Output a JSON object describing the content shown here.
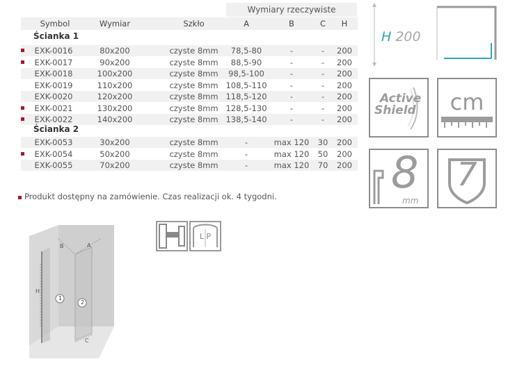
{
  "table": {
    "group_header": "Wymiary rzeczywiste",
    "columns": {
      "symbol": "Symbol",
      "wymiar": "Wymiar",
      "szklo": "Szkło",
      "a": "A",
      "b": "B",
      "c": "C",
      "h": "H"
    },
    "group1": {
      "title": "Ścianka 1",
      "rows": [
        {
          "bullet": true,
          "symbol": "EXK-0016",
          "wymiar": "80x200",
          "szklo": "czyste 8mm",
          "a": "78,5-80",
          "b": "-",
          "c": "-",
          "h": "200"
        },
        {
          "bullet": true,
          "symbol": "EXK-0017",
          "wymiar": "90x200",
          "szklo": "czyste 8mm",
          "a": "88,5-90",
          "b": "-",
          "c": "-",
          "h": "200"
        },
        {
          "bullet": false,
          "symbol": "EXK-0018",
          "wymiar": "100x200",
          "szklo": "czyste 8mm",
          "a": "98,5-100",
          "b": "-",
          "c": "-",
          "h": "200"
        },
        {
          "bullet": false,
          "symbol": "EXK-0019",
          "wymiar": "110x200",
          "szklo": "czyste 8mm",
          "a": "108,5-110",
          "b": "-",
          "c": "-",
          "h": "200"
        },
        {
          "bullet": false,
          "symbol": "EXK-0020",
          "wymiar": "120x200",
          "szklo": "czyste 8mm",
          "a": "118,5-120",
          "b": "-",
          "c": "-",
          "h": "200"
        },
        {
          "bullet": true,
          "symbol": "EXK-0021",
          "wymiar": "130x200",
          "szklo": "czyste 8mm",
          "a": "128,5-130",
          "b": "-",
          "c": "-",
          "h": "200"
        },
        {
          "bullet": true,
          "symbol": "EXK-0022",
          "wymiar": "140x200",
          "szklo": "czyste 8mm",
          "a": "138,5-140",
          "b": "-",
          "c": "-",
          "h": "200"
        }
      ]
    },
    "group2": {
      "title": "Ścianka 2",
      "rows": [
        {
          "bullet": false,
          "symbol": "EXK-0053",
          "wymiar": "30x200",
          "szklo": "czyste 8mm",
          "a": "-",
          "b": "max 120",
          "c": "30",
          "h": "200"
        },
        {
          "bullet": true,
          "symbol": "EXK-0054",
          "wymiar": "50x200",
          "szklo": "czyste 8mm",
          "a": "-",
          "b": "max 120",
          "c": "50",
          "h": "200"
        },
        {
          "bullet": false,
          "symbol": "EXK-0055",
          "wymiar": "70x200",
          "szklo": "czyste 8mm",
          "a": "-",
          "b": "max 120",
          "c": "70",
          "h": "200"
        }
      ]
    }
  },
  "note": "Produkt dostępny na zamówienie. Czas realizacji ok. 4 tygodni.",
  "icons": {
    "height_letter": "H",
    "height_value": "200",
    "active_shield_line1": "Active",
    "active_shield_line2": "Shield",
    "cm_label": "cm",
    "glass_thickness": "8",
    "glass_unit": "mm",
    "warranty_years": "7",
    "lp_label": "L P"
  },
  "diagram": {
    "label_a": "A",
    "label_b": "B",
    "label_c": "C",
    "label_h": "H",
    "label_1": "1",
    "label_2": "2"
  },
  "colors": {
    "bullet": "#a3192c",
    "teal": "#2aa6b5",
    "header_bg": "#f0f0f0"
  }
}
